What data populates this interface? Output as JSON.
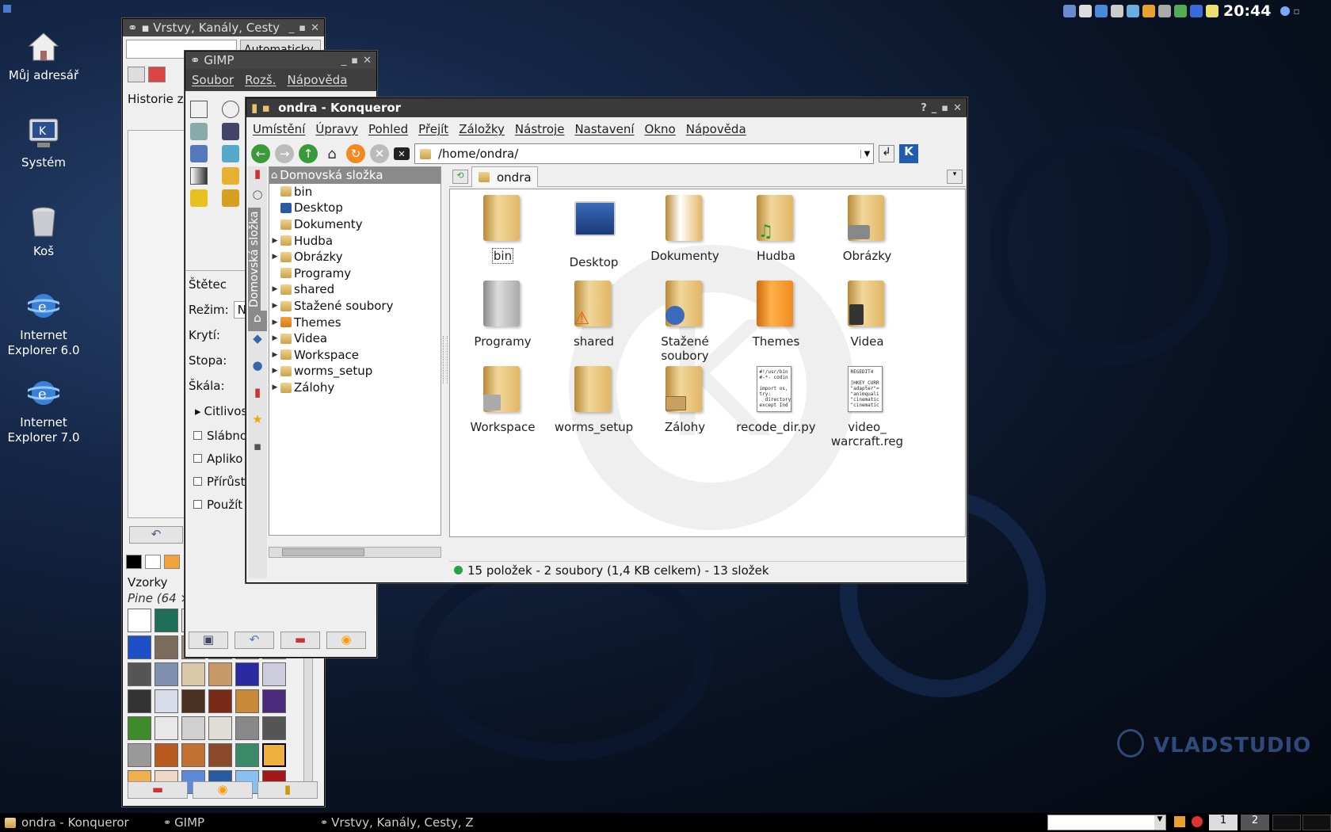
{
  "desktop": {
    "icons": [
      {
        "label": "Můj adresář",
        "icon": "home-icon"
      },
      {
        "label": "Systém",
        "icon": "system-icon"
      },
      {
        "label": "Koš",
        "icon": "trash-icon"
      },
      {
        "label": "Internet Explorer 6.0",
        "icon": "ie-icon"
      },
      {
        "label": "Internet Explorer 7.0",
        "icon": "ie-icon"
      }
    ],
    "watermark": "VLADSTUDIO"
  },
  "layers_window": {
    "title": "Vrstvy, Kanály, Cesty",
    "mode_button": "Automaticky",
    "history_label": "Historie z",
    "patterns_label": "Vzorky",
    "pattern_name": "Pine (64 ×"
  },
  "gimp_window": {
    "title": "GIMP",
    "menu": [
      "Soubor",
      "Rozš.",
      "Nápověda"
    ],
    "brush_label": "Štětec",
    "mode_label": "Režim:",
    "mode_value": "N",
    "opacity_label": "Krytí:",
    "trace_label": "Stopa:",
    "scale_label": "Škála:",
    "sensitivity_label": "Citlivos",
    "checks": [
      "Slábno",
      "Apliko",
      "Přírůst",
      "Použít"
    ]
  },
  "konqueror": {
    "title": "ondra - Konqueror",
    "menu": [
      "Umístění",
      "Úpravy",
      "Pohled",
      "Přejít",
      "Záložky",
      "Nástroje",
      "Nastavení",
      "Okno",
      "Nápověda"
    ],
    "location": "/home/ondra/",
    "tab": "ondra",
    "sidebar_tab": "Domovská složka",
    "tree_root": "Domovská složka",
    "tree": [
      "bin",
      "Desktop",
      "Dokumenty",
      "Hudba",
      "Obrázky",
      "Programy",
      "shared",
      "Stažené soubory",
      "Themes",
      "Videa",
      "Workspace",
      "worms_setup",
      "Zálohy"
    ],
    "files": [
      {
        "name": "bin",
        "type": "folder"
      },
      {
        "name": "Desktop",
        "type": "desktop"
      },
      {
        "name": "Dokumenty",
        "type": "folder"
      },
      {
        "name": "Hudba",
        "type": "folder"
      },
      {
        "name": "Obrázky",
        "type": "folder"
      },
      {
        "name": "Programy",
        "type": "folder"
      },
      {
        "name": "shared",
        "type": "folder"
      },
      {
        "name": "Stažené soubory",
        "type": "folder"
      },
      {
        "name": "Themes",
        "type": "folder"
      },
      {
        "name": "Videa",
        "type": "folder"
      },
      {
        "name": "Workspace",
        "type": "folder"
      },
      {
        "name": "worms_setup",
        "type": "folder"
      },
      {
        "name": "Zálohy",
        "type": "folder"
      },
      {
        "name": "recode_dir.py",
        "type": "script",
        "preview": "#!/usr/bin\n#-*- codin\n\nimport os,\ntry:\n  directory\nexcept Ind"
      },
      {
        "name": "video_ warcraft.reg",
        "type": "reg",
        "preview": "REGEDIT4\n\n[HKEY_CURR\n\"adapter\"=\n\"animquali\n\"cinematic\n\"cinematic"
      }
    ],
    "status": "15 položek - 2 soubory (1,4 KB celkem) - 13 složek"
  },
  "taskbar": {
    "tasks": [
      "ondra - Konqueror",
      "GIMP",
      "Vrstvy, Kanály, Cesty, Z"
    ],
    "clock": "20:44",
    "desktops": [
      "1",
      "2"
    ]
  }
}
